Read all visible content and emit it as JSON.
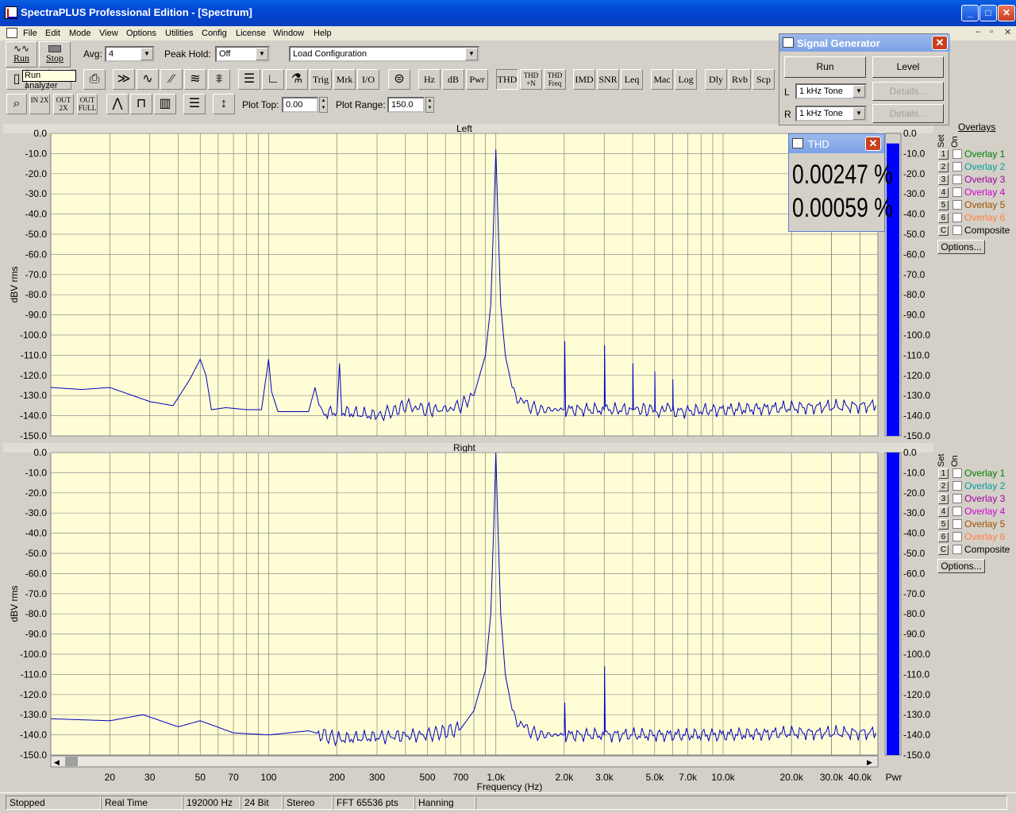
{
  "window": {
    "title": "SpectraPLUS Professional Edition - [Spectrum]"
  },
  "menu": [
    "File",
    "Edit",
    "Mode",
    "View",
    "Options",
    "Utilities",
    "Config",
    "License",
    "Window",
    "Help"
  ],
  "toolbar1": {
    "run_label": "Run",
    "stop_label": "Stop",
    "avg_label": "Avg:",
    "avg_value": "4",
    "peak_hold_label": "Peak Hold:",
    "peak_hold_value": "Off",
    "config_value": "Load Configuration",
    "tooltip": "Run analyzer"
  },
  "toolbar2": {
    "buttons": [
      "Trig",
      "Mrk",
      "I/O",
      "Hz",
      "dB",
      "Pwr",
      "THD",
      "THD +N",
      "THD Freq",
      "IMD",
      "SNR",
      "Leq",
      "Mac",
      "Log",
      "Dly",
      "Rvb",
      "Scp"
    ]
  },
  "toolbar3": {
    "plot_top_label": "Plot Top:",
    "plot_top_value": "0.00",
    "plot_range_label": "Plot Range:",
    "plot_range_value": "150.0",
    "zoom_buttons": [
      "IN 2X",
      "OUT 2X",
      "OUT FULL"
    ]
  },
  "signal_generator": {
    "title": "Signal Generator",
    "run_label": "Run",
    "level_label": "Level",
    "left_label": "L",
    "left_value": "1 kHz Tone",
    "right_label": "R",
    "right_value": "1 kHz Tone",
    "details_label": "Details..."
  },
  "thd_window": {
    "title": "THD",
    "left_value": "0.00247 %",
    "right_value": "0.00059 %"
  },
  "overlays": {
    "title": "Overlays",
    "set_label": "Set",
    "on_label": "On",
    "items": [
      {
        "set": "1",
        "label": "Overlay 1",
        "color": "#008000"
      },
      {
        "set": "2",
        "label": "Overlay 2",
        "color": "#00a0a0"
      },
      {
        "set": "3",
        "label": "Overlay 3",
        "color": "#a000a0"
      },
      {
        "set": "4",
        "label": "Overlay 4",
        "color": "#d000d0"
      },
      {
        "set": "5",
        "label": "Overlay 5",
        "color": "#a05000"
      },
      {
        "set": "6",
        "label": "Overlay 6",
        "color": "#ff8040"
      },
      {
        "set": "C",
        "label": "Composite",
        "color": "#000000"
      }
    ],
    "options_label": "Options..."
  },
  "status_bar": [
    "Stopped",
    "Real Time",
    "192000 Hz",
    "24 Bit",
    "Stereo",
    "FFT 65536 pts",
    "Hanning"
  ],
  "chart_data": [
    {
      "type": "line",
      "title": "Left",
      "ylabel": "dBV rms",
      "xlabel": "Frequency (Hz)",
      "xscale": "log",
      "xlim": [
        11,
        48000
      ],
      "ylim": [
        -150,
        0
      ],
      "yticks": [
        "0.0",
        "-10.0",
        "-20.0",
        "-30.0",
        "-40.0",
        "-50.0",
        "-60.0",
        "-70.0",
        "-80.0",
        "-90.0",
        "-100.0",
        "-110.0",
        "-120.0",
        "-130.0",
        "-140.0",
        "-150.0"
      ],
      "grid": true,
      "series": [
        {
          "color": "#0000c0",
          "points": [
            [
              11,
              -126
            ],
            [
              15,
              -127
            ],
            [
              20,
              -126
            ],
            [
              30,
              -133
            ],
            [
              38,
              -135
            ],
            [
              45,
              -122
            ],
            [
              50,
              -112
            ],
            [
              53,
              -120
            ],
            [
              56,
              -137
            ],
            [
              65,
              -136
            ],
            [
              80,
              -137
            ],
            [
              93,
              -137
            ],
            [
              100,
              -112
            ],
            [
              103,
              -128
            ],
            [
              110,
              -138
            ],
            [
              150,
              -138
            ],
            [
              160,
              -126
            ],
            [
              170,
              -139
            ],
            [
              200,
              -138
            ],
            [
              205,
              -114
            ],
            [
              210,
              -138
            ],
            [
              300,
              -140
            ],
            [
              350,
              -138
            ],
            [
              400,
              -135
            ],
            [
              500,
              -137
            ],
            [
              600,
              -137
            ],
            [
              700,
              -135
            ],
            [
              800,
              -130
            ],
            [
              900,
              -110
            ],
            [
              950,
              -85
            ],
            [
              980,
              -40
            ],
            [
              1000,
              -8
            ],
            [
              1020,
              -40
            ],
            [
              1050,
              -85
            ],
            [
              1100,
              -110
            ],
            [
              1200,
              -130
            ],
            [
              1500,
              -137
            ],
            [
              2000,
              -137
            ],
            [
              2010,
              -103
            ],
            [
              2030,
              -137
            ],
            [
              3000,
              -137
            ],
            [
              3010,
              -105
            ],
            [
              3030,
              -137
            ],
            [
              4000,
              -137
            ],
            [
              4010,
              -114
            ],
            [
              4030,
              -137
            ],
            [
              5000,
              -137
            ],
            [
              5010,
              -118
            ],
            [
              5030,
              -138
            ],
            [
              6000,
              -137
            ],
            [
              6010,
              -122
            ],
            [
              6030,
              -138
            ],
            [
              10000,
              -137
            ],
            [
              20000,
              -136
            ],
            [
              47000,
              -135
            ]
          ]
        }
      ],
      "meter_level": -5
    },
    {
      "type": "line",
      "title": "Right",
      "ylabel": "dBV rms",
      "xlabel": "Frequency (Hz)",
      "xscale": "log",
      "xlim": [
        11,
        48000
      ],
      "ylim": [
        -150,
        0
      ],
      "yticks": [
        "0.0",
        "-10.0",
        "-20.0",
        "-30.0",
        "-40.0",
        "-50.0",
        "-60.0",
        "-70.0",
        "-80.0",
        "-90.0",
        "-100.0",
        "-110.0",
        "-120.0",
        "-130.0",
        "-140.0",
        "-150.0"
      ],
      "xticks": [
        "20",
        "30",
        "50",
        "70",
        "100",
        "200",
        "300",
        "500",
        "700",
        "1.0k",
        "2.0k",
        "3.0k",
        "5.0k",
        "7.0k",
        "10.0k",
        "20.0k",
        "30.0k",
        "40.0k"
      ],
      "grid": true,
      "series": [
        {
          "color": "#0000c0",
          "points": [
            [
              11,
              -132
            ],
            [
              20,
              -133
            ],
            [
              28,
              -130
            ],
            [
              40,
              -136
            ],
            [
              50,
              -133
            ],
            [
              70,
              -139
            ],
            [
              100,
              -140
            ],
            [
              150,
              -138
            ],
            [
              200,
              -142
            ],
            [
              300,
              -141
            ],
            [
              500,
              -140
            ],
            [
              700,
              -137
            ],
            [
              800,
              -128
            ],
            [
              900,
              -108
            ],
            [
              950,
              -80
            ],
            [
              980,
              -35
            ],
            [
              1000,
              0
            ],
            [
              1020,
              -35
            ],
            [
              1050,
              -80
            ],
            [
              1100,
              -110
            ],
            [
              1200,
              -132
            ],
            [
              1500,
              -140
            ],
            [
              2000,
              -140
            ],
            [
              2010,
              -124
            ],
            [
              2030,
              -140
            ],
            [
              3000,
              -140
            ],
            [
              3010,
              -106
            ],
            [
              3030,
              -140
            ],
            [
              10000,
              -140
            ],
            [
              20000,
              -139
            ],
            [
              47000,
              -139
            ]
          ]
        }
      ],
      "meter_level": 0
    }
  ]
}
